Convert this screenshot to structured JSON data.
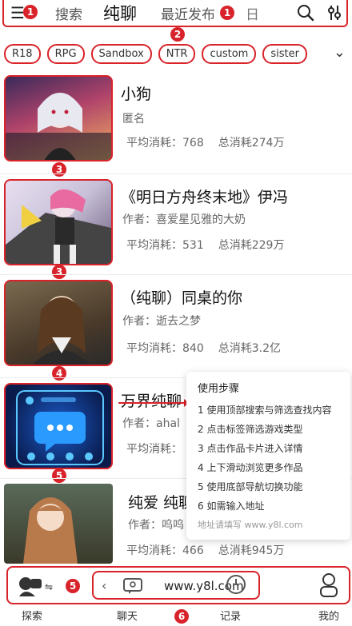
{
  "header": {
    "nav": [
      "搜索",
      "纯聊",
      "最近发布",
      "日"
    ],
    "badge_left": "1",
    "badge_right": "1",
    "annotation": "2"
  },
  "tags": [
    "R18",
    "RPG",
    "Sandbox",
    "NTR",
    "custom",
    "sister"
  ],
  "cards": [
    {
      "title": "小狗",
      "author": "匿名",
      "avg_label": "平均消耗：768",
      "total_label": "总消耗274万",
      "marker": "3"
    },
    {
      "title": "《明日方舟终末地》伊冯",
      "author": "作者：喜爱星见雅的大奶",
      "avg_label": "平均消耗：531",
      "total_label": "总消耗229万",
      "marker": "3"
    },
    {
      "title": "（纯聊）同桌的你",
      "author": "作者：逝去之梦",
      "avg_label": "平均消耗：840",
      "total_label": "总消耗3.2亿",
      "marker": "4"
    },
    {
      "title": "万界纯聊",
      "author": "作者：ahal",
      "avg_label": "平均消耗：",
      "total_label": "",
      "marker": "5"
    },
    {
      "title": "纯爱 纯聊",
      "author": "作者：呜呜",
      "avg_label": "平均消耗：466",
      "total_label": "总消耗945万",
      "marker": ""
    }
  ],
  "popup": {
    "title": "使用步骤",
    "steps": [
      "1 使用顶部搜索与筛选查找内容",
      "2 点击标签筛选游戏类型",
      "3 点击作品卡片进入详情",
      "4 上下滑动浏览更多作品",
      "5 使用底部导航切换功能",
      "6 如需输入地址"
    ],
    "footer": "地址请填写 www.y8l.com"
  },
  "bottombar": {
    "url": "www.y8l.com",
    "badge": "5",
    "annotation": "6"
  },
  "tabs": [
    "探索",
    "聊天",
    "记录",
    "我的"
  ],
  "colors": {
    "accent": "#d8232a"
  }
}
